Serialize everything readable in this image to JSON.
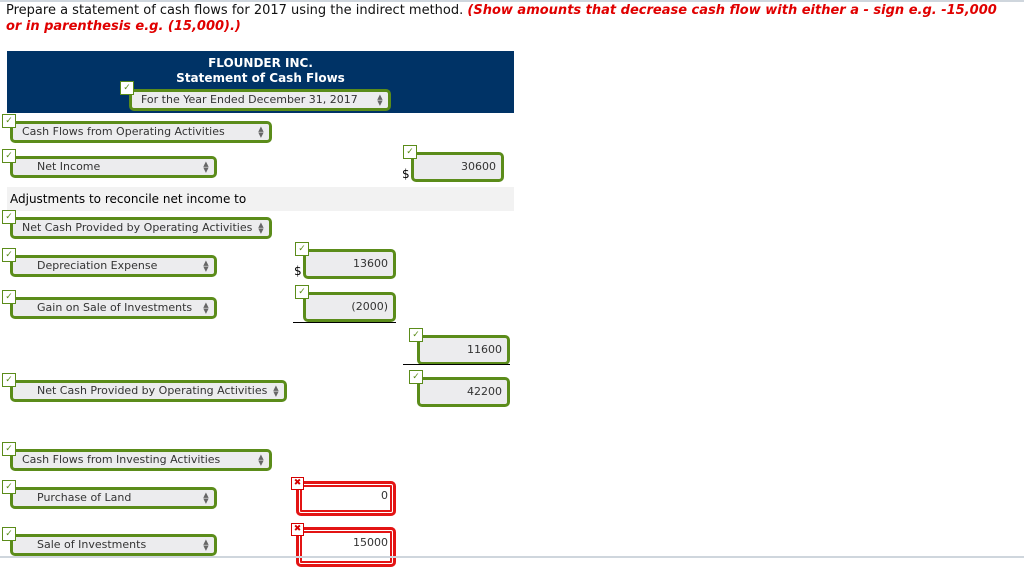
{
  "instructions": {
    "text": "Prepare a statement of cash flows for 2017 using the indirect method.",
    "emphasis": "(Show amounts that decrease cash flow with either a - sign e.g. -15,000 or in parenthesis e.g. (15,000).)"
  },
  "header": {
    "company": "FLOUNDER INC.",
    "statement": "Statement of Cash Flows",
    "period_select": "For the Year Ended December 31, 2017",
    "brand_color": "#003366"
  },
  "icons": {
    "correct": "checkmark-icon",
    "incorrect": "x-mark-icon",
    "select_arrows": "up-down-arrows-icon"
  },
  "glyphs": {
    "check": "✓",
    "x": "✖",
    "up": "▲",
    "down": "▼",
    "dollar": "$"
  },
  "colors": {
    "correct": "#5b8c1a",
    "incorrect": "#e31414",
    "instruction_emphasis": "#e00000"
  },
  "rows": {
    "operating_heading": {
      "select": "Cash Flows from Operating Activities",
      "status": "correct"
    },
    "net_income": {
      "select": "Net Income",
      "amount": "30600",
      "status": "correct"
    },
    "adjustments_label": "Adjustments to reconcile net income to",
    "adjustments_select": {
      "select": "Net Cash Provided by Operating Activities",
      "status": "correct"
    },
    "depreciation": {
      "select": "Depreciation Expense",
      "amount": "13600",
      "status": "correct"
    },
    "gain_sale": {
      "select": "Gain on Sale of Investments",
      "amount": "(2000)",
      "status": "correct"
    },
    "adjustments_total": {
      "amount": "11600",
      "status": "correct"
    },
    "net_operating": {
      "select": "Net Cash Provided by Operating Activities",
      "amount": "42200",
      "status": "correct"
    },
    "investing_heading": {
      "select": "Cash Flows from Investing Activities",
      "status": "correct"
    },
    "purchase_land": {
      "select": "Purchase of Land",
      "amount": "0",
      "status": "incorrect"
    },
    "sale_investments": {
      "select": "Sale of Investments",
      "amount": "15000",
      "status": "incorrect"
    }
  }
}
